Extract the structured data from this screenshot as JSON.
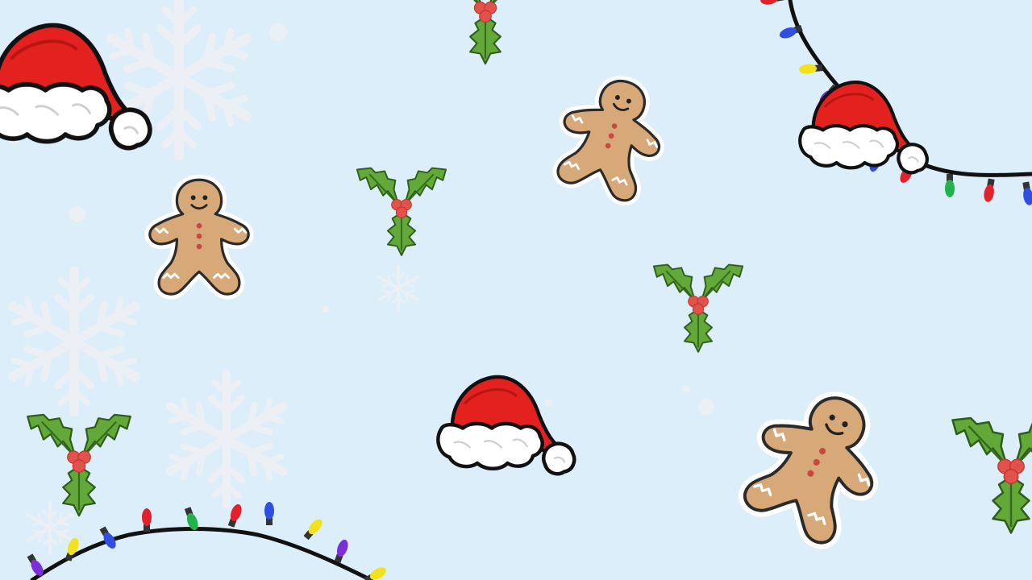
{
  "background_color": "#DDEEFB",
  "colors": {
    "hat_red": "#E3211E",
    "hat_fur": "#FFFFFF",
    "outline": "#111111",
    "gingerbread": "#D7A878",
    "icing": "#FFFFFF",
    "holly_leaf": "#63A93A",
    "holly_leaf_dark": "#356B1E",
    "holly_berry": "#E2524A",
    "wire": "#111111",
    "snowflake": "#F4F1F2",
    "bulb_colors": [
      "#7B2FD6",
      "#F2E21C",
      "#2F4FE0",
      "#E3212B",
      "#1FB34A"
    ]
  },
  "motifs": {
    "icons": [
      "santa-hat-icon",
      "gingerbread-man-icon",
      "holly-sprig-icon",
      "snowflake-icon",
      "string-lights-icon"
    ]
  }
}
